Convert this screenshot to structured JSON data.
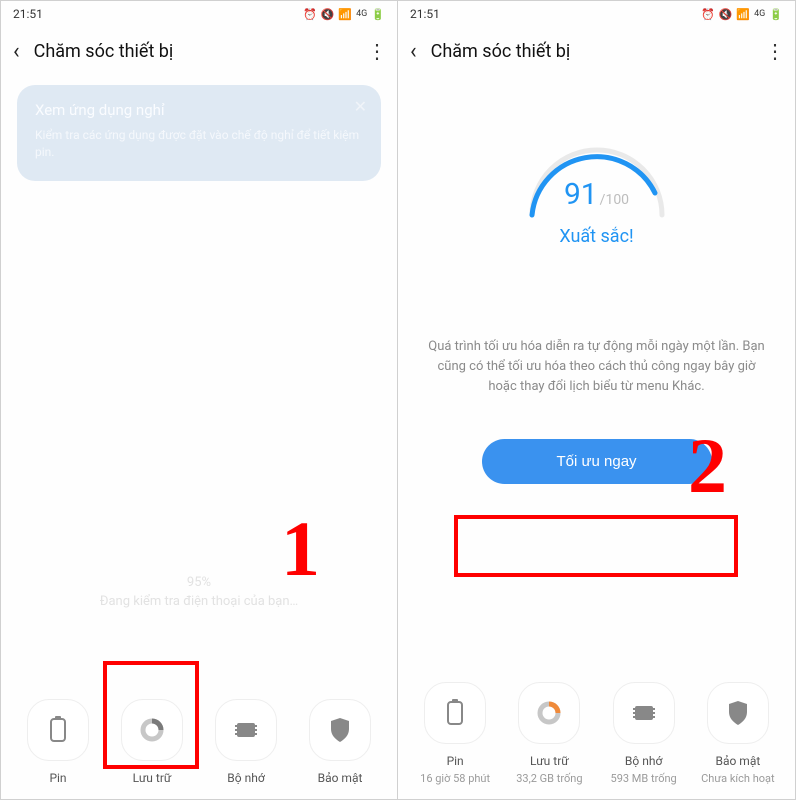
{
  "status": {
    "time": "21:51"
  },
  "appbar": {
    "title": "Chăm sóc thiết bị"
  },
  "left": {
    "card": {
      "title": "Xem ứng dụng nghỉ",
      "desc": "Kiểm tra các ứng dụng được đặt vào chế độ nghỉ để tiết kiệm pin."
    },
    "checking": {
      "percent": "95%",
      "text": "Đang kiểm tra điện thoại của bạn…"
    },
    "tiles": {
      "battery": "Pin",
      "storage": "Lưu trữ",
      "memory": "Bộ nhớ",
      "security": "Bảo mật"
    },
    "marker": "1"
  },
  "right": {
    "score": {
      "value": "91",
      "max": "/100",
      "label": "Xuất sắc!"
    },
    "desc": "Quá trình tối ưu hóa diễn ra tự động mỗi ngày một lần. Bạn cũng có thể tối ưu hóa theo cách thủ công ngay bây giờ hoặc thay đổi lịch biểu từ menu Khác.",
    "button": "Tối ưu ngay",
    "tiles": {
      "battery": {
        "label": "Pin",
        "sub": "16 giờ 58 phút"
      },
      "storage": {
        "label": "Lưu trữ",
        "sub": "33,2 GB trống"
      },
      "memory": {
        "label": "Bộ nhớ",
        "sub": "593 MB trống"
      },
      "security": {
        "label": "Bảo mật",
        "sub": "Chưa kích hoạt"
      }
    },
    "marker": "2"
  },
  "icons": {
    "battery_svg": "battery",
    "storage_svg": "donut",
    "memory_svg": "chip",
    "security_svg": "shield"
  }
}
